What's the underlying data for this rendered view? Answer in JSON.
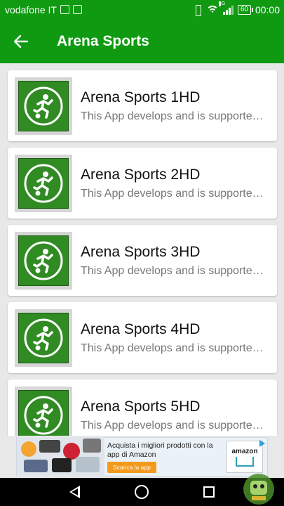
{
  "status_bar": {
    "carrier": "vodafone IT",
    "network_label": "3G",
    "battery": "60",
    "time": "00:00"
  },
  "app_bar": {
    "title": "Arena Sports"
  },
  "items": [
    {
      "title": "Arena Sports 1HD",
      "description": "This App develops and is supported..."
    },
    {
      "title": "Arena Sports 2HD",
      "description": "This App develops and is supported..."
    },
    {
      "title": "Arena Sports 3HD",
      "description": "This App develops and is supported..."
    },
    {
      "title": "Arena Sports 4HD",
      "description": "This App develops and is supported..."
    },
    {
      "title": "Arena Sports 5HD",
      "description": "This App develops and is supported..."
    }
  ],
  "ad": {
    "text": "Acquista i migliori prodotti con la app di Amazon",
    "button": "Scarica la app",
    "brand": "amazon"
  },
  "colors": {
    "primary": "#0f9a11",
    "icon_green": "#2f8b22",
    "card_bg": "#ffffff",
    "screen_bg": "#e8e8e8"
  },
  "icons": {
    "back": "arrow-left-icon",
    "app_thumb": "soccer-player-icon"
  }
}
